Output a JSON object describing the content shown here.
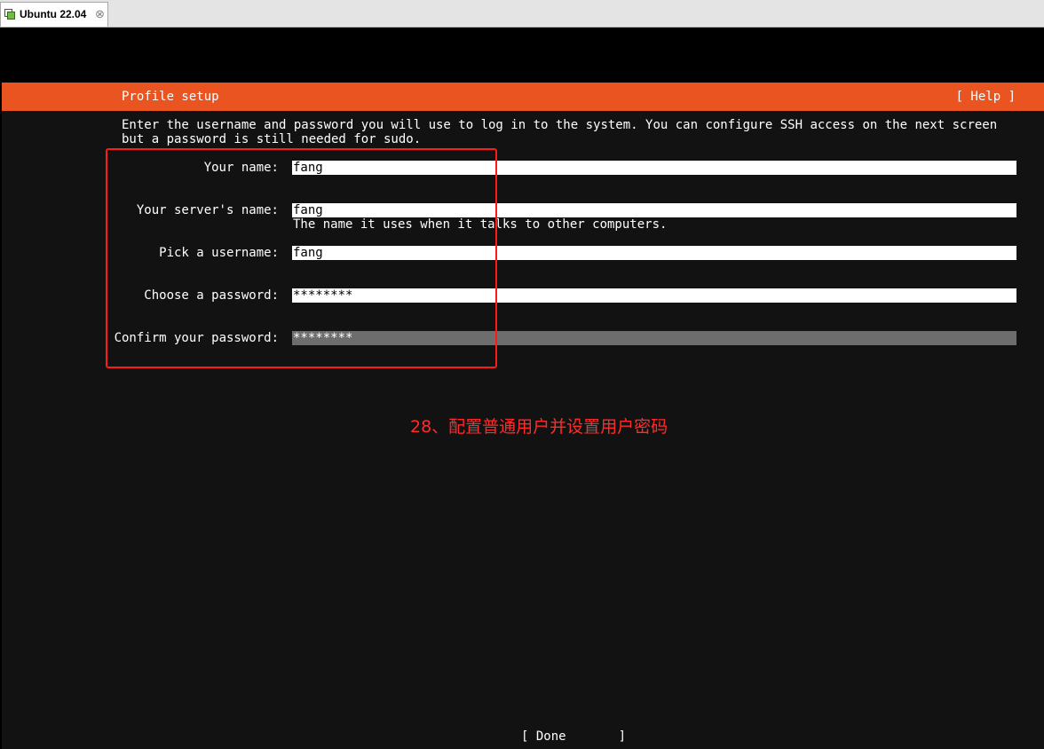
{
  "window": {
    "tab_title": "Ubuntu 22.04",
    "close_glyph": "⊗"
  },
  "installer": {
    "header_title": "Profile setup",
    "help_label": "[ Help ]",
    "description": "Enter the username and password you will use to log in to the system. You can configure SSH access on the next screen but a password is still needed for sudo.",
    "fields": [
      {
        "label": "Your name:",
        "value": "fang"
      },
      {
        "label": "Your server's name:",
        "value": "fang",
        "hint": "The name it uses when it talks to other computers."
      },
      {
        "label": "Pick a username:",
        "value": "fang"
      },
      {
        "label": "Choose a password:",
        "value": "********"
      },
      {
        "label": "Confirm your password:",
        "value": "********"
      }
    ],
    "done_label": "[ Done       ]"
  },
  "annotation": {
    "text": "28、配置普通用户并设置用户密码",
    "color": "#ff2a2a"
  },
  "colors": {
    "header": "#e95420",
    "background": "#121212",
    "active_field": "#6d6d6d"
  }
}
